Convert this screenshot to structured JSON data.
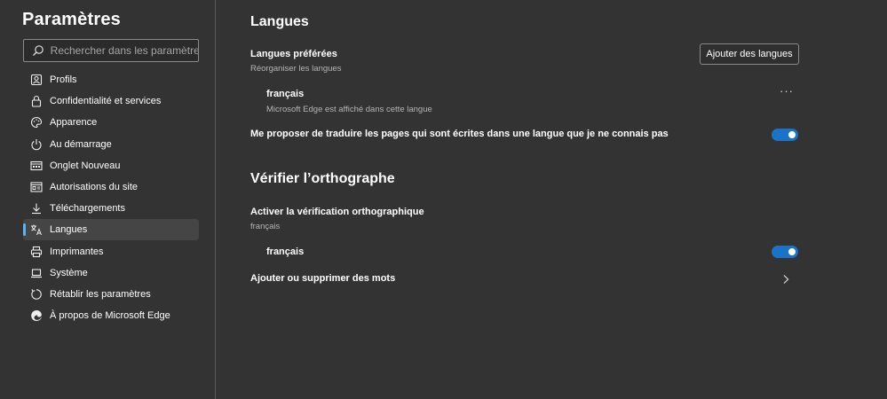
{
  "sidebar": {
    "title": "Paramètres",
    "search_placeholder": "Rechercher dans les paramètres",
    "items": [
      {
        "label": "Profils",
        "icon": "profile-icon"
      },
      {
        "label": "Confidentialité et services",
        "icon": "lock-icon"
      },
      {
        "label": "Apparence",
        "icon": "palette-icon"
      },
      {
        "label": "Au démarrage",
        "icon": "power-icon"
      },
      {
        "label": "Onglet Nouveau",
        "icon": "new-tab-icon"
      },
      {
        "label": "Autorisations du site",
        "icon": "site-permissions-icon"
      },
      {
        "label": "Téléchargements",
        "icon": "download-icon"
      },
      {
        "label": "Langues",
        "icon": "languages-icon",
        "active": true
      },
      {
        "label": "Imprimantes",
        "icon": "printer-icon"
      },
      {
        "label": "Système",
        "icon": "laptop-icon"
      },
      {
        "label": "Rétablir les paramètres",
        "icon": "reset-icon"
      },
      {
        "label": "À propos de Microsoft Edge",
        "icon": "edge-logo-icon"
      }
    ]
  },
  "languages": {
    "title": "Langues",
    "preferred_label": "Langues préférées",
    "preferred_sub": "Réorganiser les langues",
    "add_button": "Ajouter des langues",
    "lang_name": "français",
    "lang_sub": "Microsoft Edge est affiché dans cette langue",
    "translate_label": "Me proposer de traduire les pages qui sont écrites dans une langue que je ne connais pas",
    "translate_on": true
  },
  "spellcheck": {
    "title": "Vérifier l’orthographe",
    "enable_label": "Activer la vérification orthographique",
    "enable_sub": "français",
    "lang_name": "français",
    "lang_on": true,
    "add_remove_words": "Ajouter ou supprimer des mots"
  },
  "colors": {
    "accent": "#1a73c8",
    "active_indicator": "#5fb2f2",
    "background": "#333333"
  }
}
